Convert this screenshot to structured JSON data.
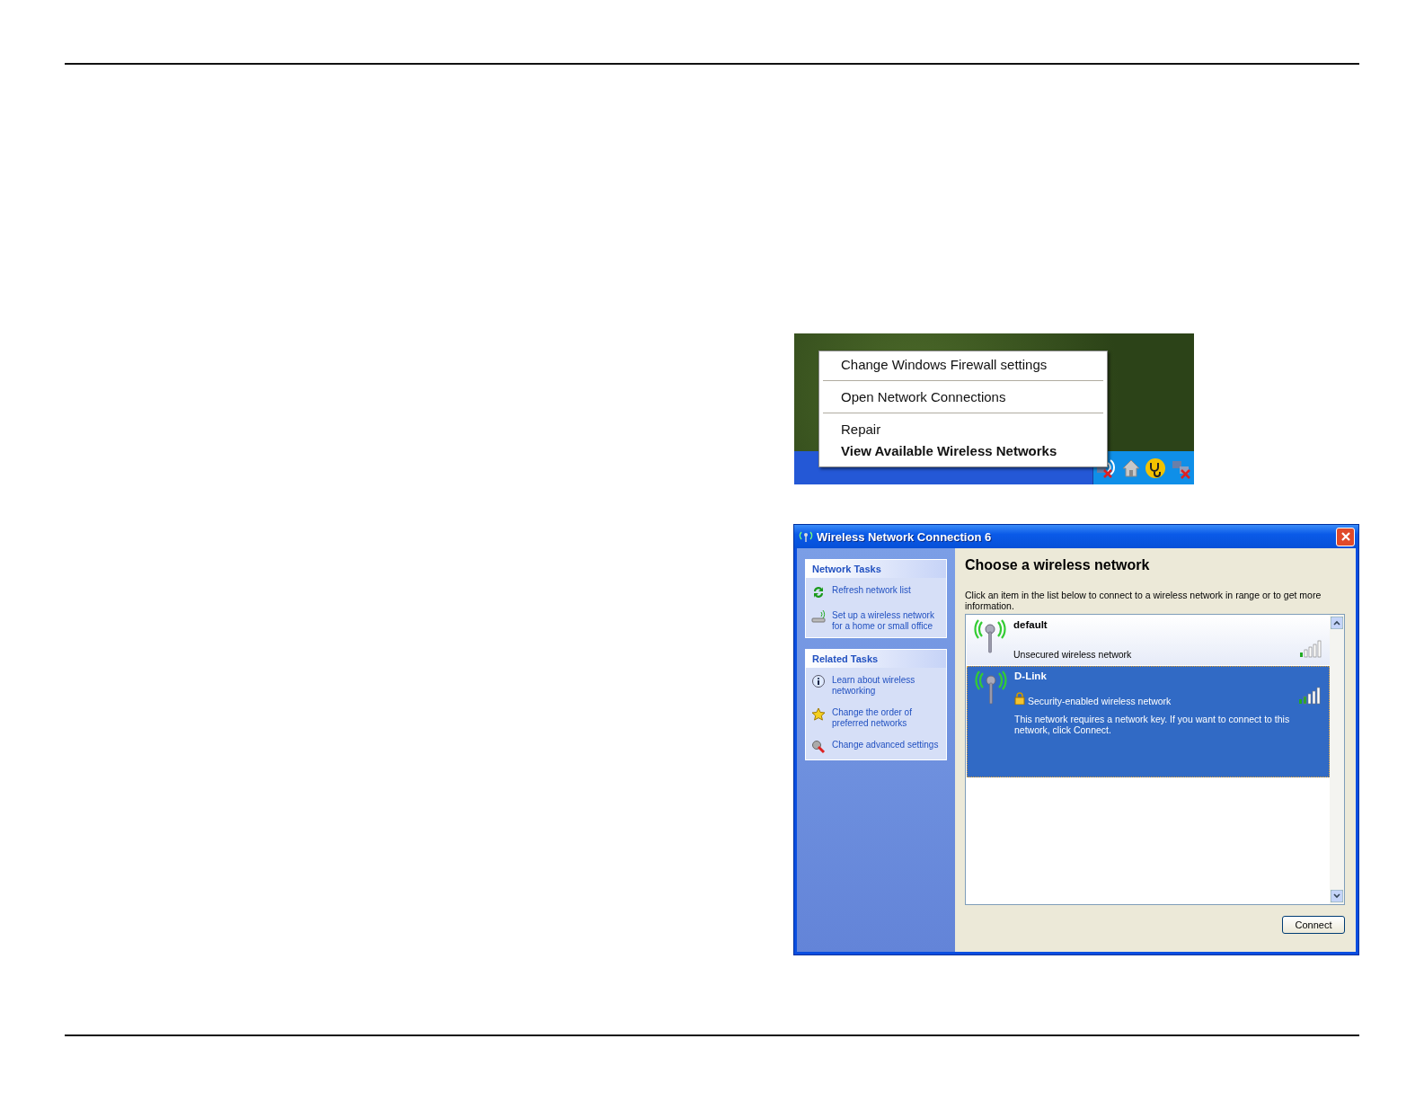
{
  "context_menu": {
    "items": [
      {
        "label": "Change Windows Firewall settings",
        "default": false,
        "separator_after": true
      },
      {
        "label": "Open Network Connections",
        "default": false,
        "separator_after": true
      },
      {
        "label": "Repair",
        "default": false,
        "separator_after": false
      },
      {
        "label": "View Available Wireless Networks",
        "default": true,
        "separator_after": false
      }
    ]
  },
  "dialog": {
    "title": "Wireless Network Connection 6",
    "task_groups": [
      {
        "title": "Network Tasks",
        "items": [
          {
            "label": "Refresh network list",
            "kind": "refresh"
          },
          {
            "label": "Set up a wireless network for a home or small office",
            "kind": "setup"
          }
        ]
      },
      {
        "title": "Related Tasks",
        "items": [
          {
            "label": "Learn about wireless networking",
            "kind": "info"
          },
          {
            "label": "Change the order of preferred networks",
            "kind": "star"
          },
          {
            "label": "Change advanced settings",
            "kind": "tools"
          }
        ]
      }
    ],
    "heading": "Choose a wireless network",
    "instructions": "Click an item in the list below to connect to a wireless network in range or to get more information.",
    "networks": [
      {
        "name": "default",
        "security": "Unsecured wireless network",
        "secured": false,
        "selected": false
      },
      {
        "name": "D-Link",
        "security": "Security-enabled wireless network",
        "secured": true,
        "selected": true,
        "message": "This network requires a network key. If you want to connect to this network, click Connect."
      }
    ],
    "button": "Connect"
  }
}
